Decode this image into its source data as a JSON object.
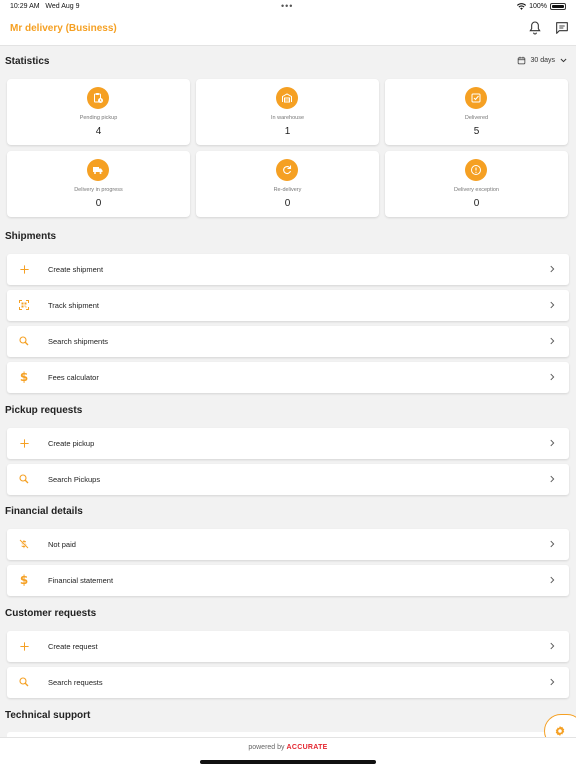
{
  "status_bar": {
    "time": "10:29 AM",
    "date": "Wed Aug 9",
    "battery": "100%"
  },
  "app": {
    "title": "Mr delivery (Business)",
    "accent_color": "#f5a023"
  },
  "statistics": {
    "title": "Statistics",
    "range_label": "30 days",
    "cards": [
      {
        "label": "Pending pickup",
        "value": "4",
        "icon": "clipboard-clock-icon"
      },
      {
        "label": "In warehouse",
        "value": "1",
        "icon": "warehouse-icon"
      },
      {
        "label": "Delivered",
        "value": "5",
        "icon": "check-box-icon"
      },
      {
        "label": "Delivery in progress",
        "value": "0",
        "icon": "truck-icon"
      },
      {
        "label": "Re-delivery",
        "value": "0",
        "icon": "refresh-icon"
      },
      {
        "label": "Delivery exception",
        "value": "0",
        "icon": "alert-icon"
      }
    ]
  },
  "shipments": {
    "title": "Shipments",
    "items": [
      {
        "label": "Create shipment",
        "icon": "plus-icon"
      },
      {
        "label": "Track shipment",
        "icon": "qr-scan-icon"
      },
      {
        "label": "Search shipments",
        "icon": "search-icon"
      },
      {
        "label": "Fees calculator",
        "icon": "dollar-icon"
      }
    ]
  },
  "pickup_requests": {
    "title": "Pickup requests",
    "items": [
      {
        "label": "Create pickup",
        "icon": "plus-icon"
      },
      {
        "label": "Search Pickups",
        "icon": "search-icon"
      }
    ]
  },
  "financial_details": {
    "title": "Financial details",
    "items": [
      {
        "label": "Not paid",
        "icon": "money-off-icon"
      },
      {
        "label": "Financial statement",
        "icon": "dollar-icon"
      }
    ]
  },
  "customer_requests": {
    "title": "Customer requests",
    "items": [
      {
        "label": "Create request",
        "icon": "plus-icon"
      },
      {
        "label": "Search requests",
        "icon": "search-icon"
      }
    ]
  },
  "technical_support": {
    "title": "Technical support"
  },
  "footer": {
    "powered_by": "powered by",
    "brand": "ACCURATE"
  }
}
